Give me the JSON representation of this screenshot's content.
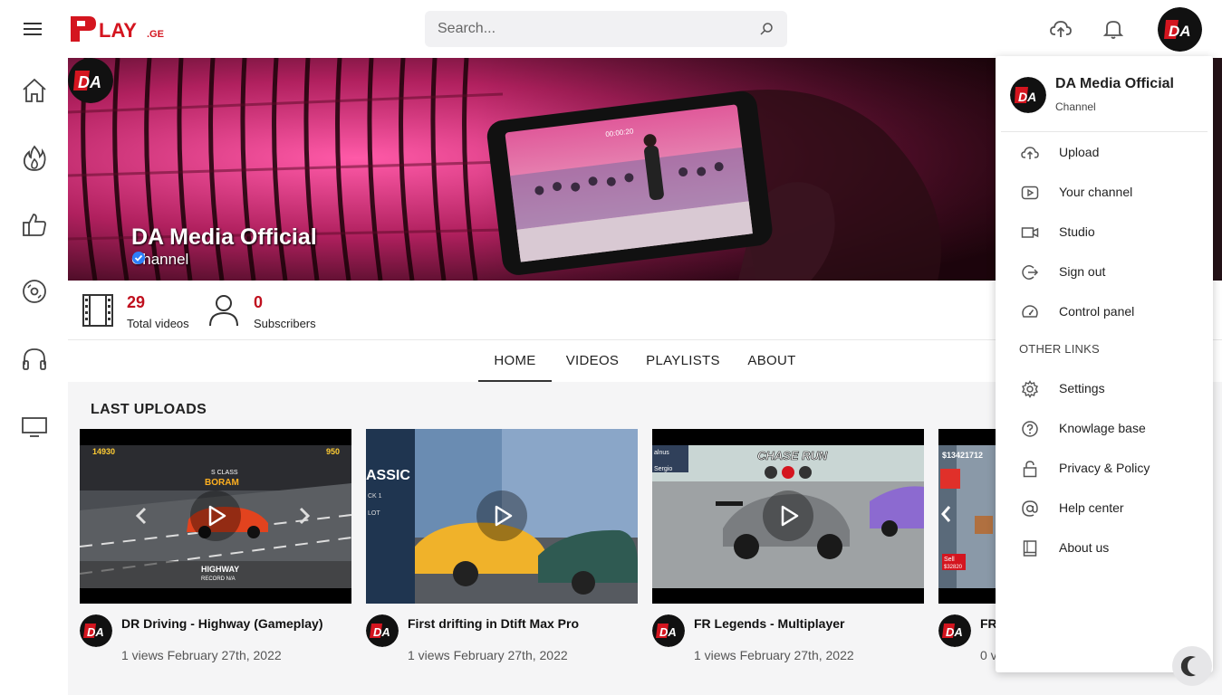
{
  "header": {
    "search_placeholder": "Search...",
    "logo_alt": "PLAY.GE"
  },
  "channel": {
    "name": "DA Media Official",
    "type": "Channel",
    "total_videos": "29",
    "total_videos_label": "Total videos",
    "subscribers": "0",
    "subscribers_label": "Subscribers"
  },
  "tabs": [
    {
      "label": "HOME",
      "active": true
    },
    {
      "label": "VIDEOS",
      "active": false
    },
    {
      "label": "PLAYLISTS",
      "active": false
    },
    {
      "label": "ABOUT",
      "active": false
    }
  ],
  "section": {
    "title": "LAST UPLOADS"
  },
  "videos": [
    {
      "title": "DR Driving - Highway (Gameplay)",
      "meta": "1 views February 27th, 2022"
    },
    {
      "title": "First drifting in Dtift Max Pro",
      "meta": "1 views February 27th, 2022"
    },
    {
      "title": "FR Legends - Multiplayer",
      "meta": "1 views February 27th, 2022"
    },
    {
      "title": "FR",
      "meta": "0 v"
    }
  ],
  "dropdown": {
    "name": "DA Media Official",
    "type": "Channel",
    "items": [
      {
        "label": "Upload",
        "icon": "upload-cloud-icon"
      },
      {
        "label": "Your channel",
        "icon": "play-box-icon"
      },
      {
        "label": "Studio",
        "icon": "video-camera-icon"
      },
      {
        "label": "Sign out",
        "icon": "sign-out-icon"
      },
      {
        "label": "Control panel",
        "icon": "dashboard-icon"
      }
    ],
    "other_header": "OTHER LINKS",
    "other_items": [
      {
        "label": "Settings",
        "icon": "gear-icon"
      },
      {
        "label": "Knowlage base",
        "icon": "help-circle-icon"
      },
      {
        "label": "Privacy & Policy",
        "icon": "lock-icon"
      },
      {
        "label": "Help center",
        "icon": "at-icon"
      },
      {
        "label": "About us",
        "icon": "book-icon"
      }
    ]
  },
  "colors": {
    "brand_red": "#c0101e",
    "accent_blue": "#2d7ff9"
  }
}
